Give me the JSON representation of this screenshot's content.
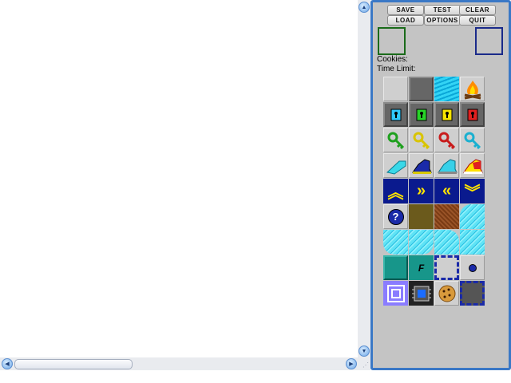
{
  "toolbar": {
    "save_label": "SAVE",
    "test_label": "TEST",
    "clear_label": "CLEAR",
    "load_label": "LOAD",
    "options_label": "OPTIONS",
    "quit_label": "QUIT"
  },
  "info": {
    "cookies_label": "Cookies:",
    "time_limit_label": "Time Limit:"
  },
  "colors": {
    "panel_border": "#3a78c6",
    "primary_preview": "#1a6b1a",
    "secondary_preview": "#1a2a8a"
  },
  "tiles": {
    "hint_glyph": "?",
    "fire_boots_glyph": "F"
  }
}
